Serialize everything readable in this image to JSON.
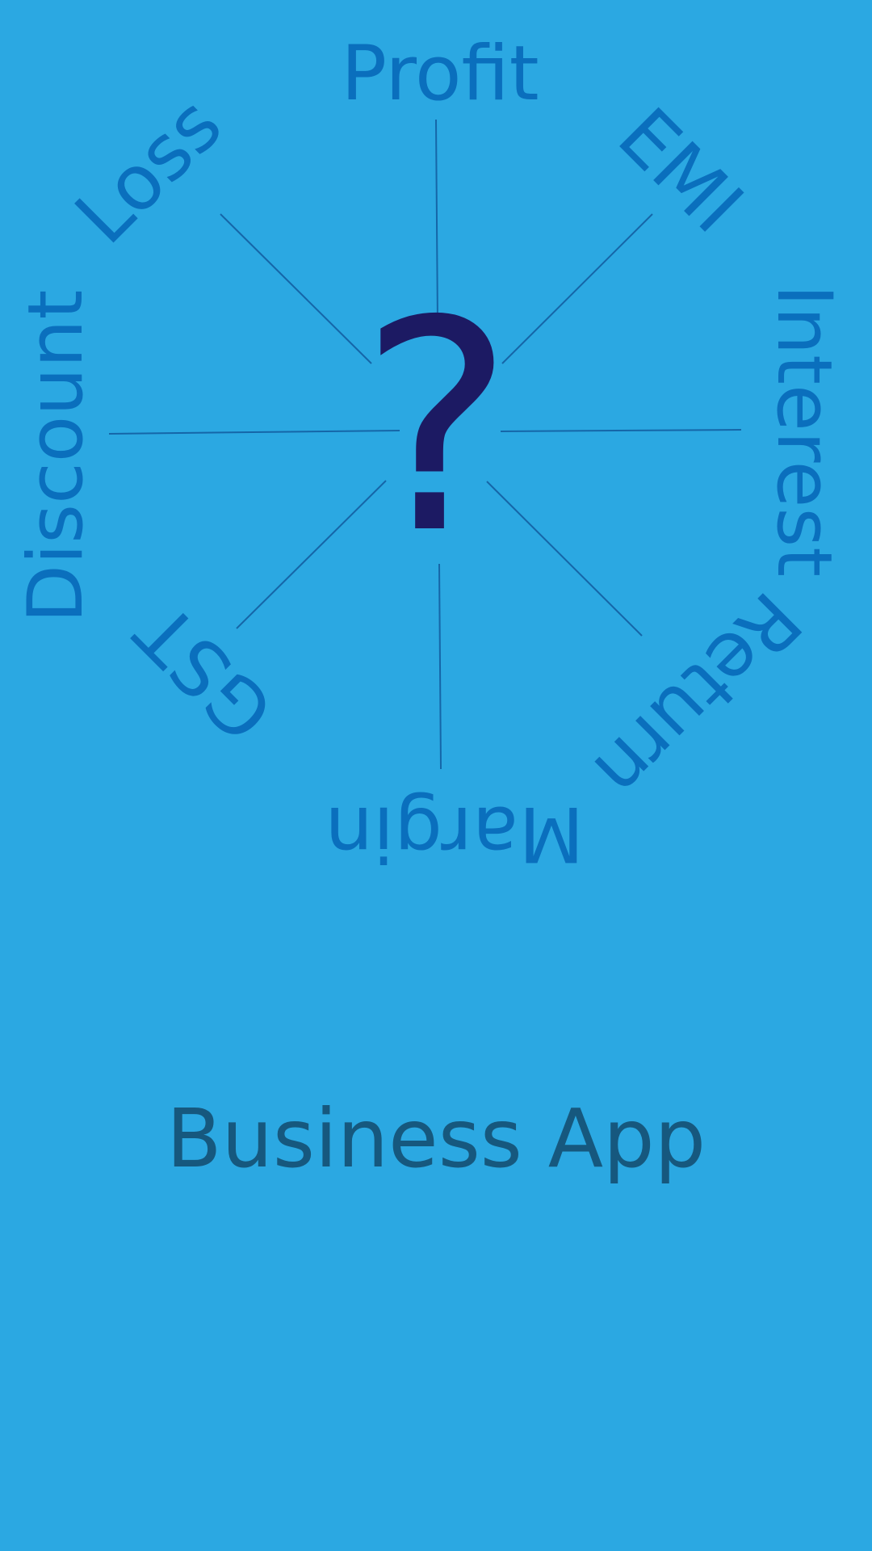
{
  "splash": {
    "app_name": "Business App",
    "center_symbol": "?",
    "topics": [
      {
        "label": "Profit"
      },
      {
        "label": "EMI"
      },
      {
        "label": "Interest"
      },
      {
        "label": "Return"
      },
      {
        "label": "Margin"
      },
      {
        "label": "GST"
      },
      {
        "label": "Discount"
      },
      {
        "label": "Loss"
      }
    ]
  },
  "colors": {
    "background": "#2ba8e2",
    "topic_text": "#0a6fbd",
    "spoke_line": "#1566a8",
    "question_mark": "#1c1a63",
    "app_name": "#16587e"
  }
}
